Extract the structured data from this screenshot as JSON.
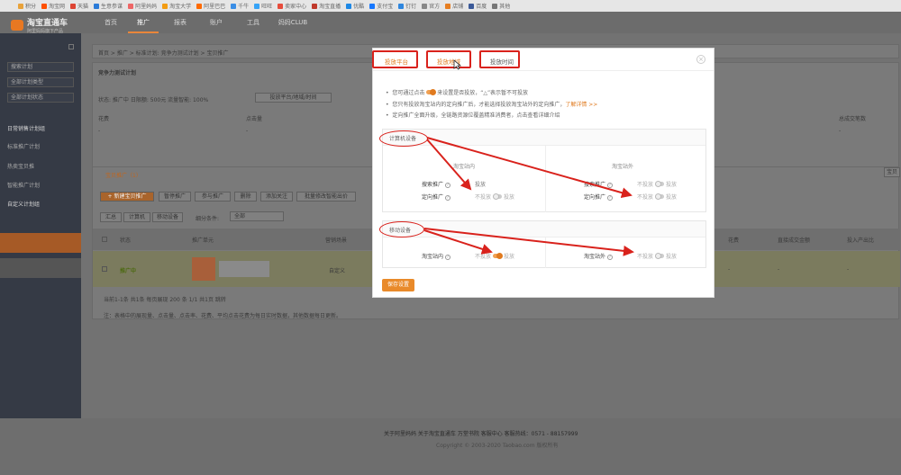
{
  "bookmarks": [
    "积分",
    "淘宝网",
    "天猫",
    "生意参谋",
    "阿里妈妈",
    "淘宝大学",
    "阿里巴巴",
    "千牛",
    "旺旺",
    "卖家中心",
    "淘宝直播",
    "优酷",
    "支付宝",
    "钉钉",
    "官方",
    "店铺",
    "百度",
    "其他"
  ],
  "logo": {
    "title": "淘宝直通车",
    "subtitle": "阿里妈妈旗下产品"
  },
  "topnav": [
    "首页",
    "推广",
    "报表",
    "账户",
    "工具",
    "妈妈CLUB"
  ],
  "sidebar": {
    "search_placeholder": "搜索计划",
    "filter1": "全部计划类型",
    "filter2": "全部计划状态",
    "group1": "日常销售计划组",
    "items": [
      "标准推广计划",
      "热卖宝贝推",
      "智能推广计划"
    ],
    "group2": "自定义计划组"
  },
  "main": {
    "breadcrumb": "首页 > 推广 > 标准计划: 竞争力测试计划 > 宝贝推广",
    "plan_title": "竞争力测试计划",
    "status_line": "状态: 推广中  日限额: 500元  流量智能: 100%",
    "status_btn": "投放平台/地域/时间",
    "cols": [
      "花费",
      "点击量",
      "总成交笔数"
    ],
    "dashes": "-",
    "tab_label": "宝贝推广（1）",
    "action_buttons": [
      "+ 新建宝贝推广",
      "暂停推广",
      "参与推广",
      "删除",
      "添加关注",
      "批量修改智能出价"
    ],
    "view_buttons": [
      "汇总",
      "计算机",
      "移动设备"
    ],
    "segment_label": "细分条件:",
    "segment_value": "全部",
    "table_headers": [
      "状态",
      "推广单元",
      "营销场景",
      "花费",
      "直接成交金额",
      "投入产出比"
    ],
    "row": {
      "status": "推广中",
      "scene": "自定义",
      "values": [
        "-",
        "-",
        "-"
      ]
    },
    "pagination": "当前1-1条 共1条 每页展现 200 条 1/1 共1页 跳转",
    "note": "注：表格中的展现量、点击量、点击率、花费、平均点击花费为每日实时数据，其他数据每日更新。",
    "right_btn1": "宝贝"
  },
  "footer": {
    "links": "关于阿里妈妈  关于淘宝直通车  万堂书院  客服中心  客服热线：0571 - 88157999",
    "copyright": "Copyright © 2003-2020 Taobao.com 版权所有"
  },
  "modal": {
    "tabs": [
      "投放平台",
      "投放地域",
      "投放时间"
    ],
    "info": [
      "您可通过点击",
      "来设置是否投放，“△”表示暂不可投放",
      "您只有投放淘宝站内的定向推广后，才能选择投放淘宝站外的定向推广，",
      "了解详情 >>",
      "定向推广全面升级，全链路资源位覆盖精准消费者，点击查看详细介绍"
    ],
    "pc_section": {
      "title": "计算机设备",
      "col_left": "淘宝站内",
      "col_right": "淘宝站外",
      "row1": "搜索推广",
      "row2": "定向推广",
      "on": "投放",
      "off": "不投放"
    },
    "mobile_section": {
      "title": "移动设备",
      "row_left": "淘宝站内",
      "row_right": "淘宝站外",
      "on": "投放",
      "off": "不投放"
    },
    "save": "保存设置"
  },
  "colors": {
    "accent": "#e07a1f",
    "annotation": "#d9221c"
  }
}
